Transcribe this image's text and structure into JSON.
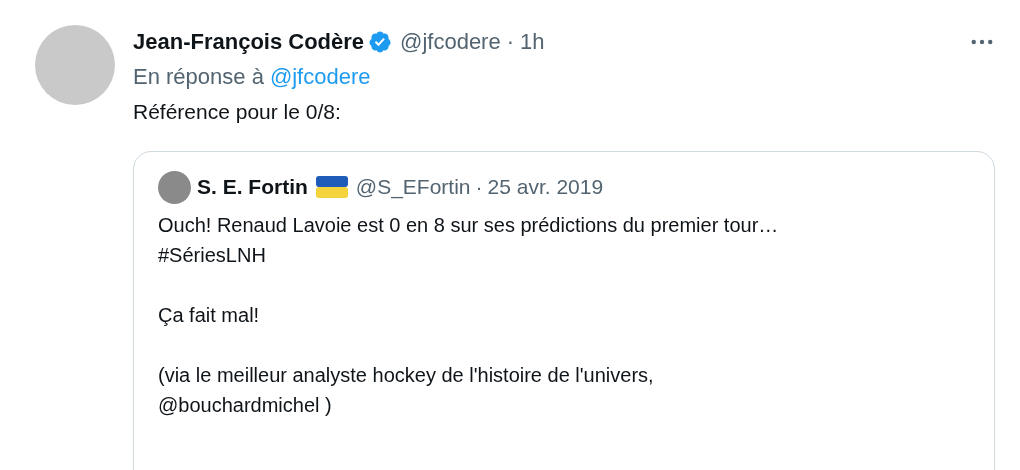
{
  "tweet": {
    "name": "Jean-François Codère",
    "verified": true,
    "handle": "@jfcodere",
    "separator": "·",
    "time": "1h",
    "reply_prefix": "En réponse à",
    "reply_handle": "@jfcodere",
    "text": "Référence pour le 0/8:",
    "quote": {
      "name": "S. E. Fortin",
      "handle": "@S_EFortin",
      "separator": "·",
      "date": "25 avr. 2019",
      "paragraphs": [
        [
          "Ouch! Renaud Lavoie est 0 en 8 sur ses prédictions du premier tour…",
          "#SériesLNH"
        ],
        [
          "Ça fait mal!"
        ],
        [
          "(via le meilleur analyste hockey de l'histoire de l'univers,",
          "@bouchardmichel )"
        ]
      ]
    }
  }
}
